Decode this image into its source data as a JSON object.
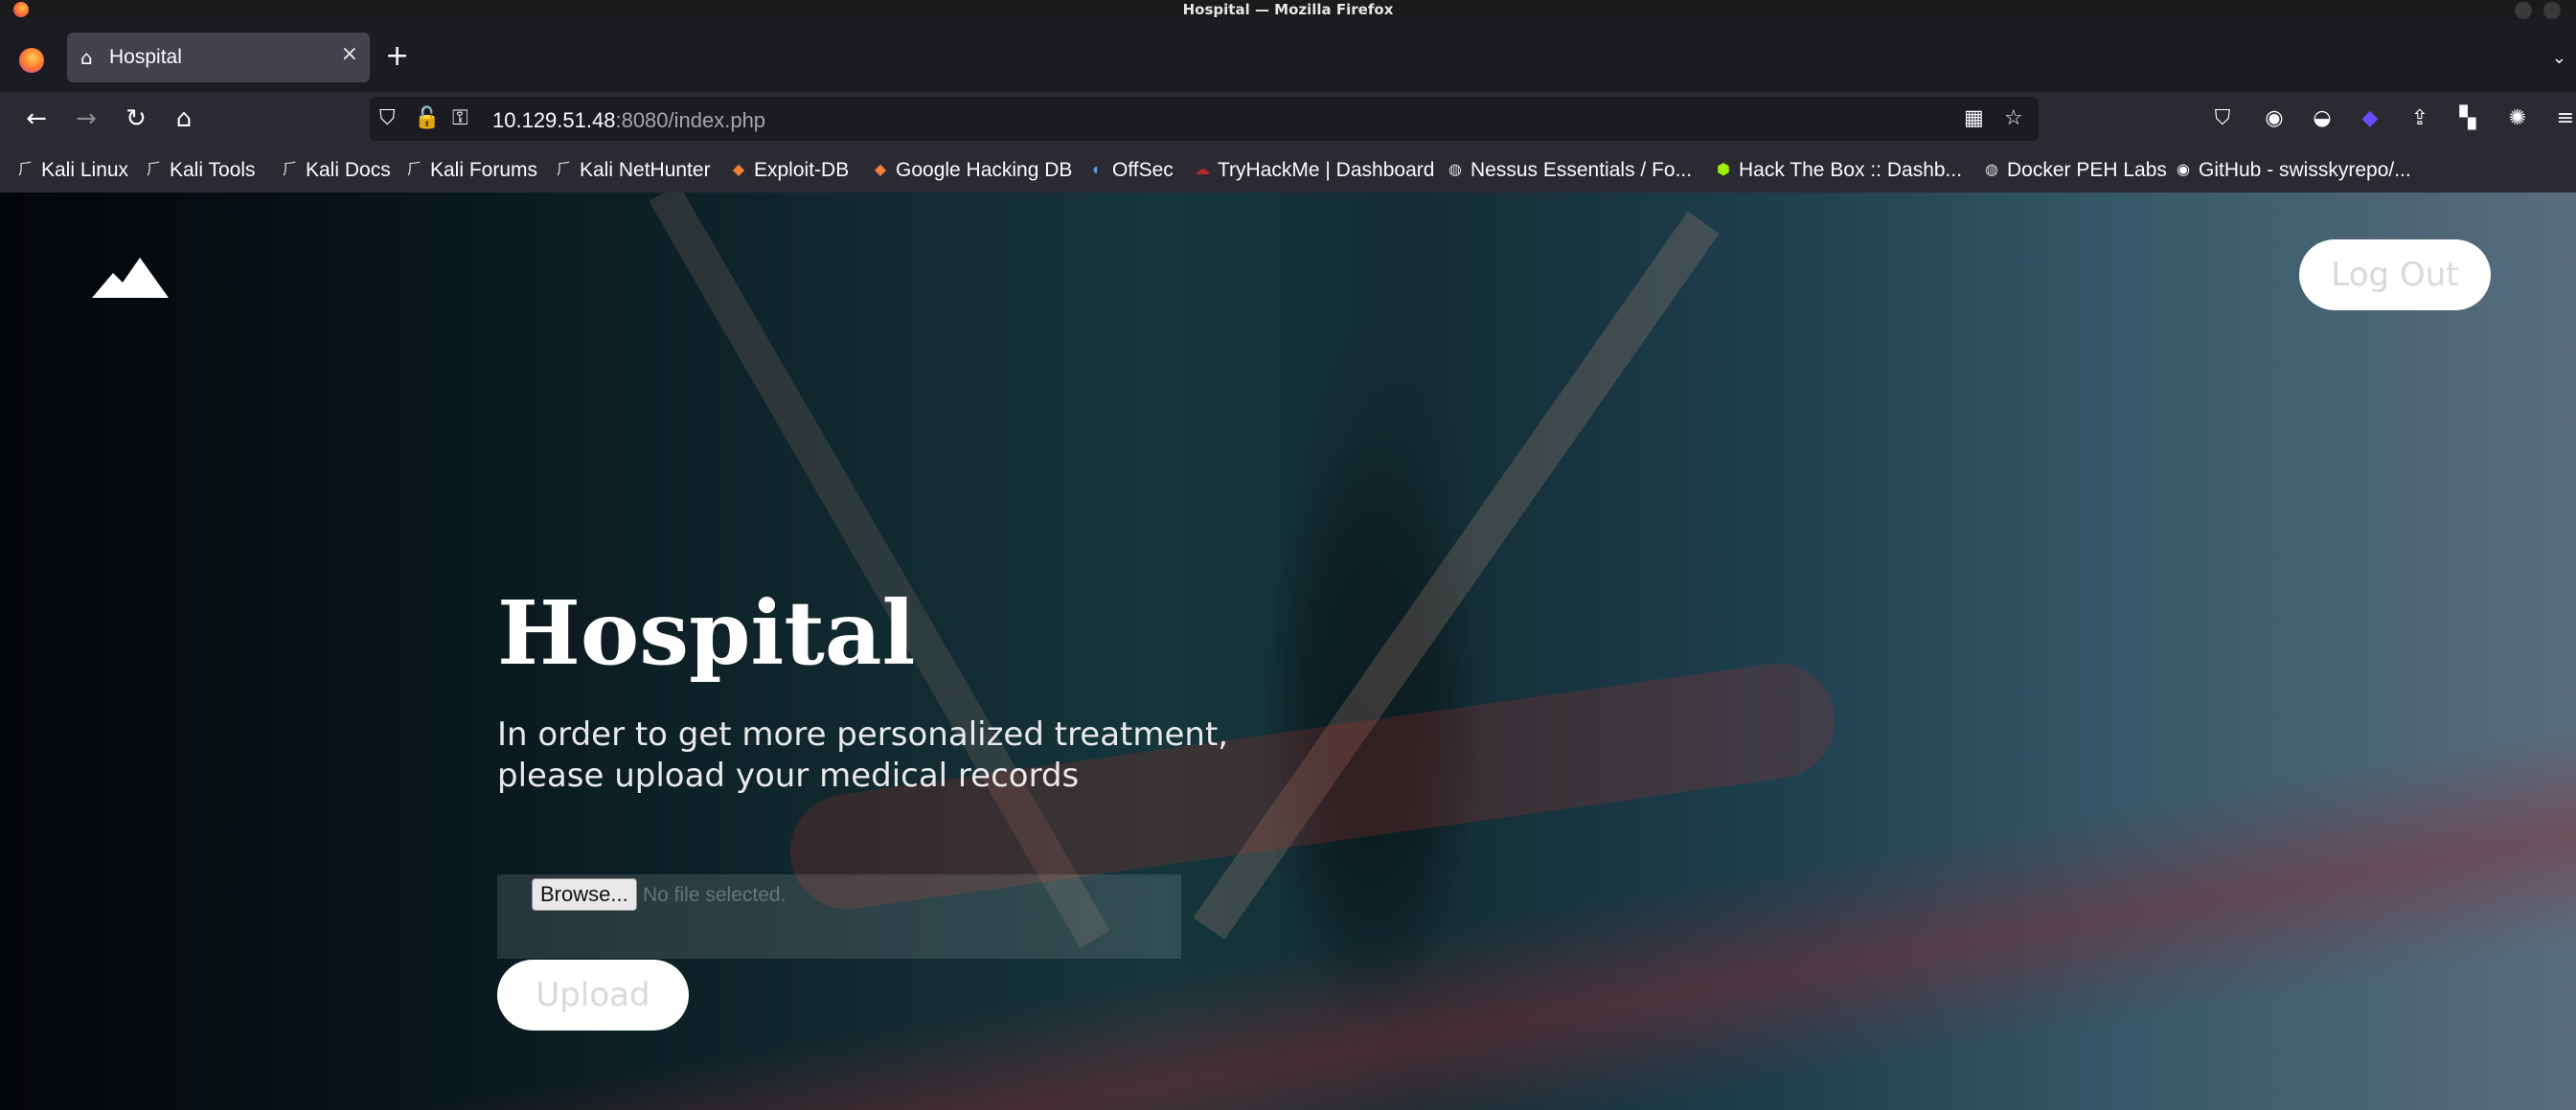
{
  "window": {
    "title": "Hospital — Mozilla Firefox"
  },
  "tab": {
    "title": "Hospital",
    "close": "×",
    "new_tab": "+"
  },
  "url": {
    "host": "10.129.51.48",
    "rest": ":8080/index.php"
  },
  "bookmarks": [
    {
      "label": "Kali Linux",
      "icon": "kali-dragon"
    },
    {
      "label": "Kali Tools",
      "icon": "kali-dragon"
    },
    {
      "label": "Kali Docs",
      "icon": "kali-dragon"
    },
    {
      "label": "Kali Forums",
      "icon": "kali-dragon"
    },
    {
      "label": "Kali NetHunter",
      "icon": "kali-dragon"
    },
    {
      "label": "Exploit-DB",
      "icon": "exploit-db"
    },
    {
      "label": "Google Hacking DB",
      "icon": "exploit-db"
    },
    {
      "label": "OffSec",
      "icon": "offsec"
    },
    {
      "label": "TryHackMe | Dashboard",
      "icon": "tryhackme"
    },
    {
      "label": "Nessus Essentials / Fo...",
      "icon": "globe"
    },
    {
      "label": "Hack The Box :: Dashb...",
      "icon": "htb-cube"
    },
    {
      "label": "Docker PEH Labs",
      "icon": "globe"
    },
    {
      "label": "GitHub - swisskyrepo/...",
      "icon": "github"
    }
  ],
  "page": {
    "logout_label": "Log Out",
    "title": "Hospital",
    "subtitle_line1": "In order to get more personalized treatment,",
    "subtitle_line2": "please upload your medical records",
    "browse_label": "Browse...",
    "no_file_label": "No file selected.",
    "upload_label": "Upload"
  }
}
